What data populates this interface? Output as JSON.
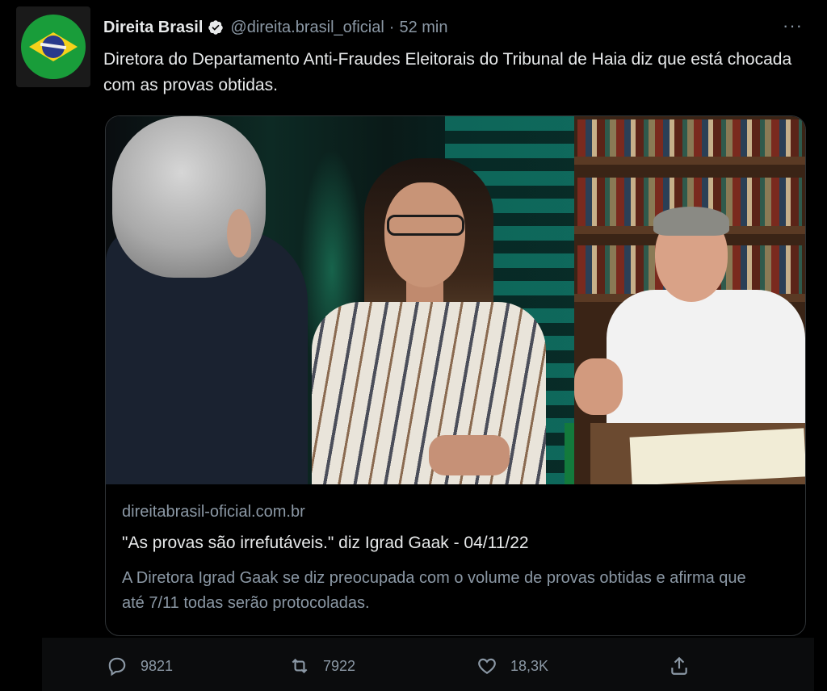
{
  "author": {
    "name": "Direita Brasil",
    "handle": "@direita.brasil_oficial",
    "separator": "·",
    "time": "52 min",
    "more_label": "···"
  },
  "tweet": {
    "text": "Diretora do Departamento Anti-Fraudes Eleitorais do Tribunal de Haia diz que está chocada com as provas obtidas."
  },
  "card": {
    "domain": "direitabrasil-oficial.com.br",
    "title": "\"As provas são irrefutáveis.\" diz Igrad Gaak - 04/11/22",
    "description": "A Diretora Igrad Gaak se diz preocupada com o volume de provas obtidas e afirma que até 7/11 todas serão protocoladas."
  },
  "actions": {
    "replies": "9821",
    "retweets": "7922",
    "likes": "18,3K"
  },
  "colors": {
    "background": "#000000",
    "text_primary": "#e7e9ea",
    "text_secondary": "#8b98a5",
    "border": "#2f3336",
    "verified_badge": "#e7e9ea"
  },
  "icons": {
    "verified": "verified-badge-icon",
    "reply": "reply-icon",
    "retweet": "retweet-icon",
    "like": "heart-icon",
    "share": "share-icon",
    "more": "more-options-icon"
  }
}
